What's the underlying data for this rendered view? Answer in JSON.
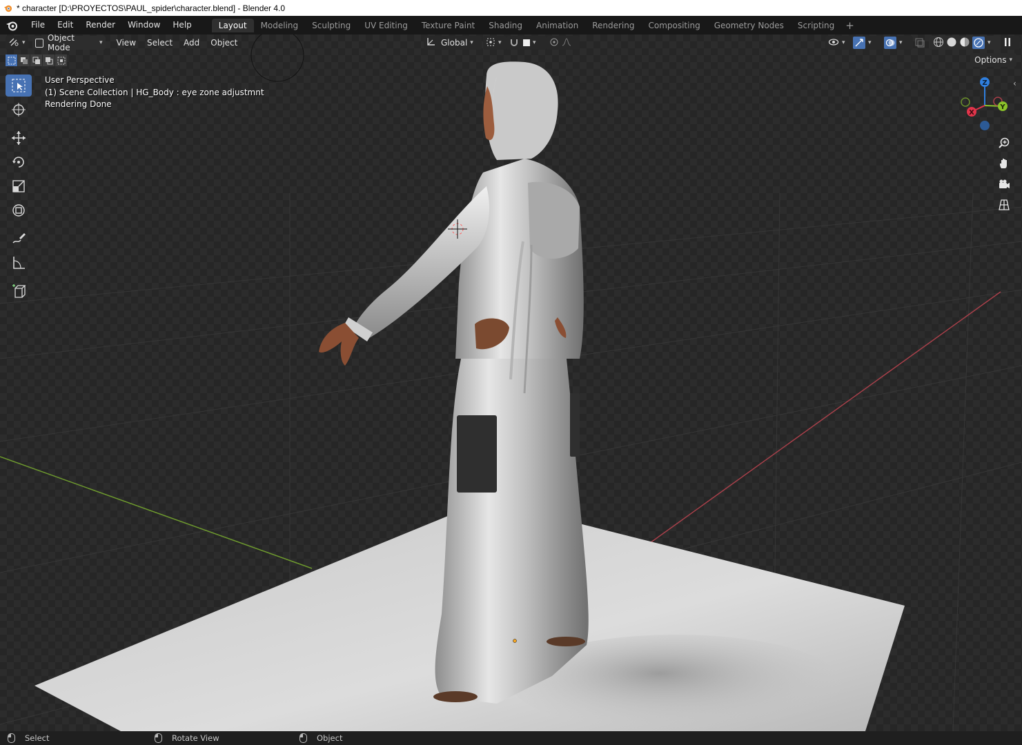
{
  "window": {
    "title": "* character [D:\\PROYECTOS\\PAUL_spider\\character.blend] - Blender 4.0"
  },
  "menu": {
    "items": [
      "File",
      "Edit",
      "Render",
      "Window",
      "Help"
    ]
  },
  "workspaces": {
    "tabs": [
      "Layout",
      "Modeling",
      "Sculpting",
      "UV Editing",
      "Texture Paint",
      "Shading",
      "Animation",
      "Rendering",
      "Compositing",
      "Geometry Nodes",
      "Scripting"
    ],
    "active": "Layout",
    "add_symbol": "+"
  },
  "viewport_header": {
    "mode": "Object Mode",
    "menus": [
      "View",
      "Select",
      "Add",
      "Object"
    ],
    "transform_orientation": "Global",
    "options_label": "Options"
  },
  "overlay": {
    "view_name": "User Perspective",
    "collection": "(1) Scene Collection | HG_Body : eye zone adjustmnt",
    "status": "Rendering Done"
  },
  "gizmo": {
    "x_label": "X",
    "y_label": "Y",
    "z_label": "Z",
    "x_color": "#e2354b",
    "y_color": "#8bc32a",
    "z_color": "#2f7fdf"
  },
  "toolbar": {
    "tools": [
      "select-box-icon",
      "cursor-icon",
      "move-icon",
      "rotate-icon",
      "scale-icon",
      "transform-icon",
      "annotate-icon",
      "measure-icon",
      "add-cube-icon"
    ],
    "active": "select-box-icon"
  },
  "statusbar": {
    "select": "Select",
    "rotate_view": "Rotate View",
    "object": "Object"
  },
  "colors": {
    "accent": "#4772b3",
    "topbar": "#181818",
    "viewport_grid_x": "#a8404a",
    "viewport_grid_y": "#6e9a2e"
  }
}
